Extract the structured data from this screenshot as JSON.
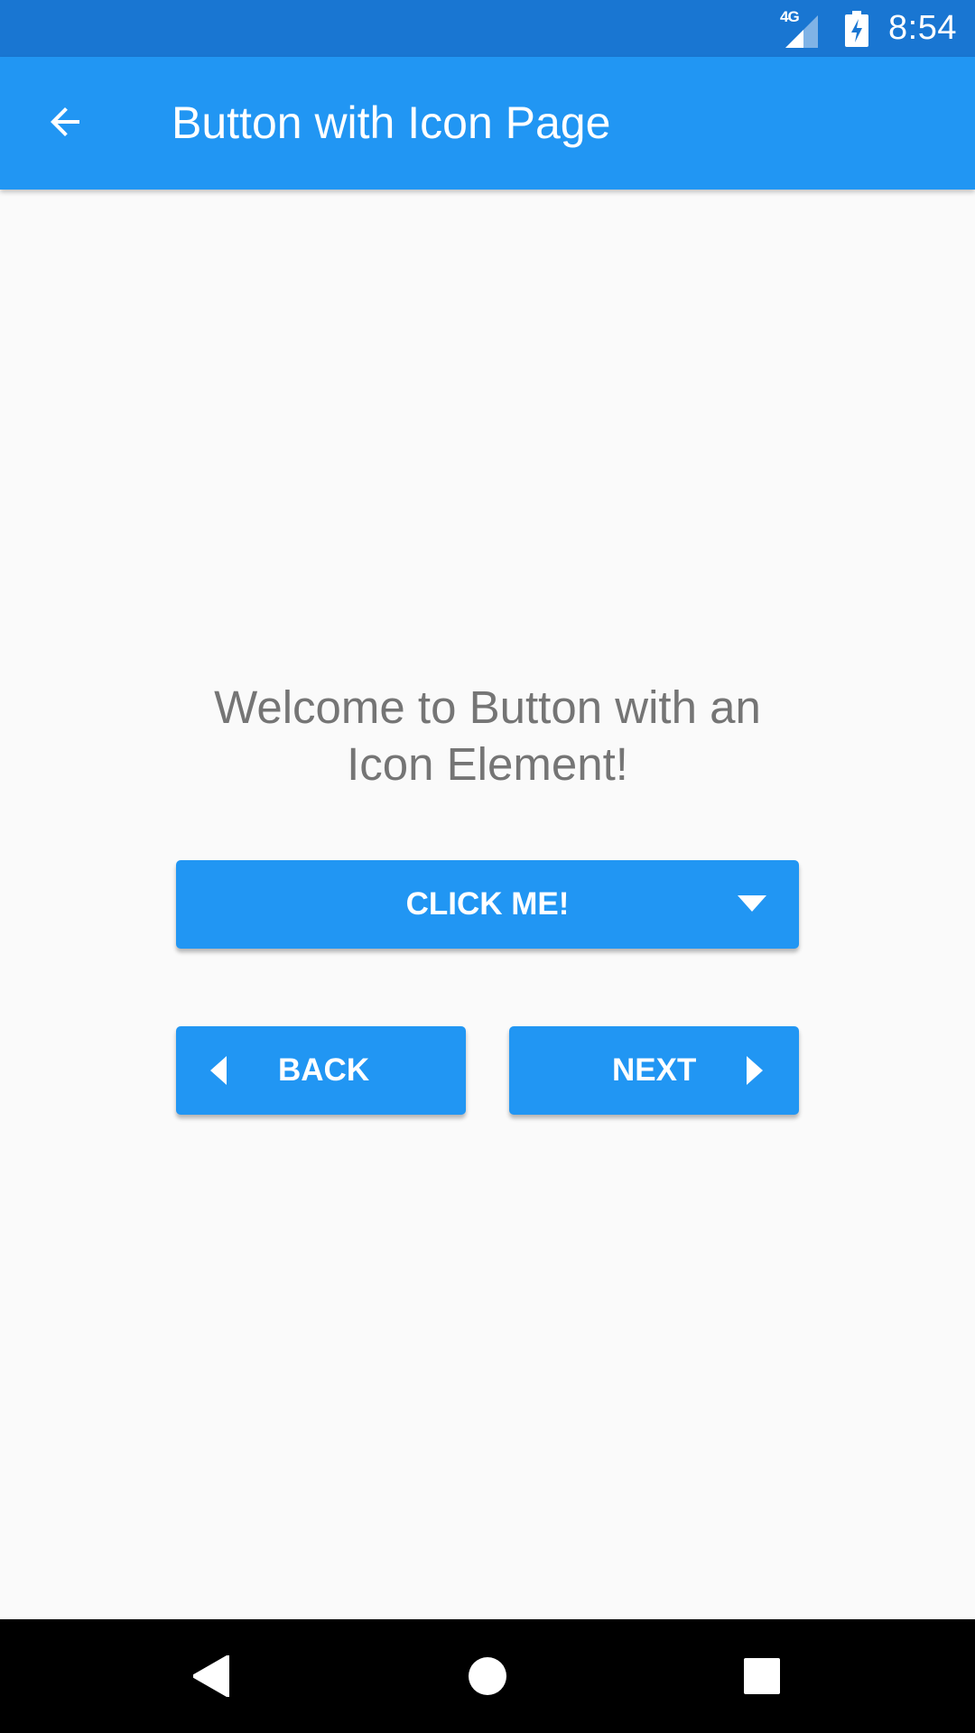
{
  "status_bar": {
    "network_label": "4G",
    "time": "8:54",
    "icons": [
      "signal-icon",
      "battery-charging-icon"
    ]
  },
  "app_bar": {
    "title": "Button with Icon Page",
    "back_icon": "arrow-left-icon"
  },
  "content": {
    "welcome_line1": "Welcome to Button with an",
    "welcome_line2": "Icon Element!"
  },
  "buttons": {
    "click_me": {
      "label": "CLICK ME!",
      "icon": "caret-down-icon"
    },
    "back": {
      "label": "BACK",
      "icon": "caret-left-icon"
    },
    "next": {
      "label": "NEXT",
      "icon": "caret-right-icon"
    }
  },
  "nav_bar": {
    "icons": [
      "nav-back-icon",
      "nav-home-icon",
      "nav-recents-icon"
    ]
  },
  "colors": {
    "status_bar": "#1976d2",
    "primary": "#2196f3",
    "background": "#fafafa",
    "welcome_text": "#757575",
    "nav_bar": "#000000"
  }
}
